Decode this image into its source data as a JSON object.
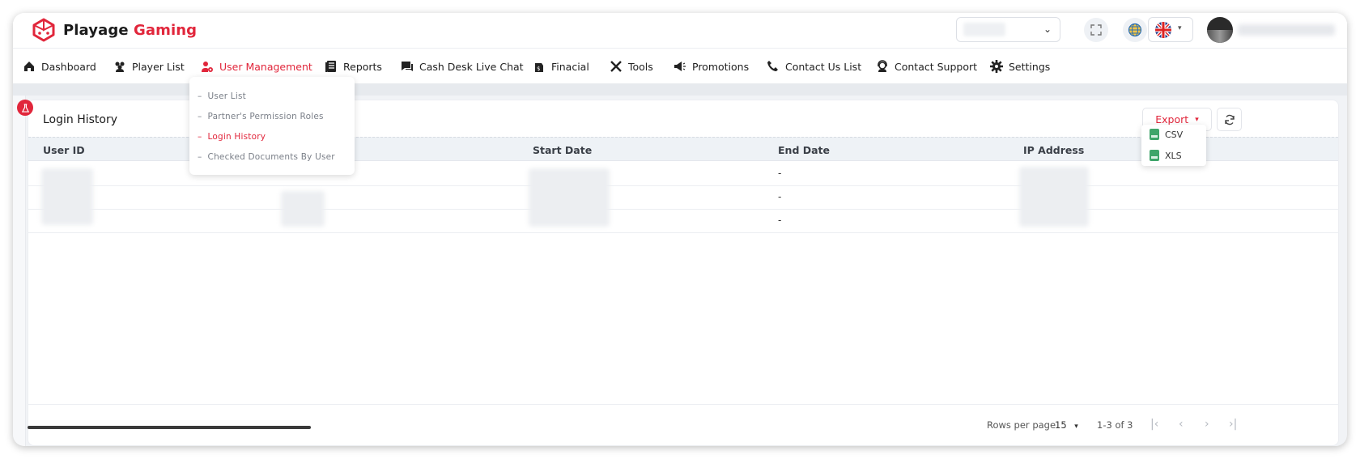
{
  "brand": {
    "name": "Playage",
    "name_accent": "Gaming",
    "color": "#e1263b"
  },
  "nav": [
    {
      "label": "Dashboard",
      "icon": "home-icon"
    },
    {
      "label": "Player List",
      "icon": "users-icon"
    },
    {
      "label": "User Management",
      "icon": "user-gear-icon",
      "active": true
    },
    {
      "label": "Reports",
      "icon": "report-icon"
    },
    {
      "label": "Cash Desk Live Chat",
      "icon": "chat-icon"
    },
    {
      "label": "Finacial",
      "icon": "finance-icon"
    },
    {
      "label": "Tools",
      "icon": "tools-icon"
    },
    {
      "label": "Promotions",
      "icon": "megaphone-icon"
    },
    {
      "label": "Contact Us List",
      "icon": "phone-icon"
    },
    {
      "label": "Contact Support",
      "icon": "support-icon"
    },
    {
      "label": "Settings",
      "icon": "gear-icon"
    }
  ],
  "submenu": [
    {
      "label": "User List"
    },
    {
      "label": "Partner's Permission Roles"
    },
    {
      "label": "Login History",
      "active": true
    },
    {
      "label": "Checked Documents By User"
    }
  ],
  "page": {
    "title": "Login History"
  },
  "toolbar": {
    "export_label": "Export"
  },
  "export_menu": [
    {
      "label": "CSV"
    },
    {
      "label": "XLS"
    }
  ],
  "table": {
    "columns": [
      "User ID",
      "Start Date",
      "End Date",
      "IP Address"
    ],
    "rows": [
      {
        "end_date": "-"
      },
      {
        "end_date": "-"
      },
      {
        "end_date": "-"
      }
    ]
  },
  "pagination": {
    "rows_per_page_label": "Rows per page",
    "rows_per_page": "15",
    "range": "1-3 of 3"
  }
}
